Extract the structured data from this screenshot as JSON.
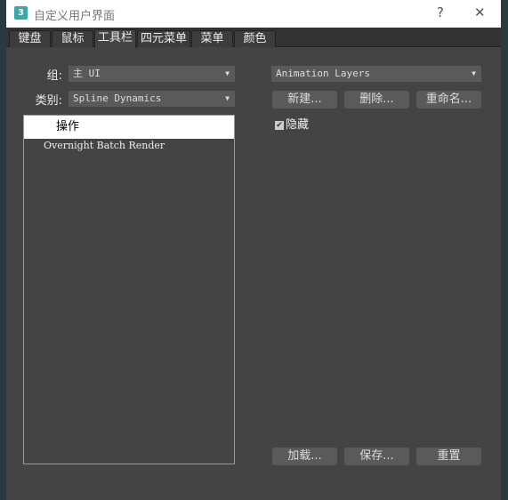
{
  "window": {
    "title": "自定义用户界面",
    "help": "?",
    "close": "✕",
    "logo": "3"
  },
  "tabs": [
    {
      "label": "键盘"
    },
    {
      "label": "鼠标"
    },
    {
      "label": "工具栏",
      "active": true
    },
    {
      "label": "四元菜单"
    },
    {
      "label": "菜单"
    },
    {
      "label": "颜色"
    }
  ],
  "left": {
    "group_label": "组:",
    "group_value": "主 UI",
    "category_label": "类别:",
    "category_value": "Spline Dynamics",
    "actions": [
      "操作",
      "Overnight Batch Render"
    ]
  },
  "right": {
    "toolbar_value": "Animation Layers",
    "new": "新建...",
    "delete": "删除...",
    "rename": "重命名...",
    "hide_label": "隐藏",
    "hide_checked": true
  },
  "bottom": {
    "load": "加载...",
    "save": "保存...",
    "reset": "重置"
  }
}
